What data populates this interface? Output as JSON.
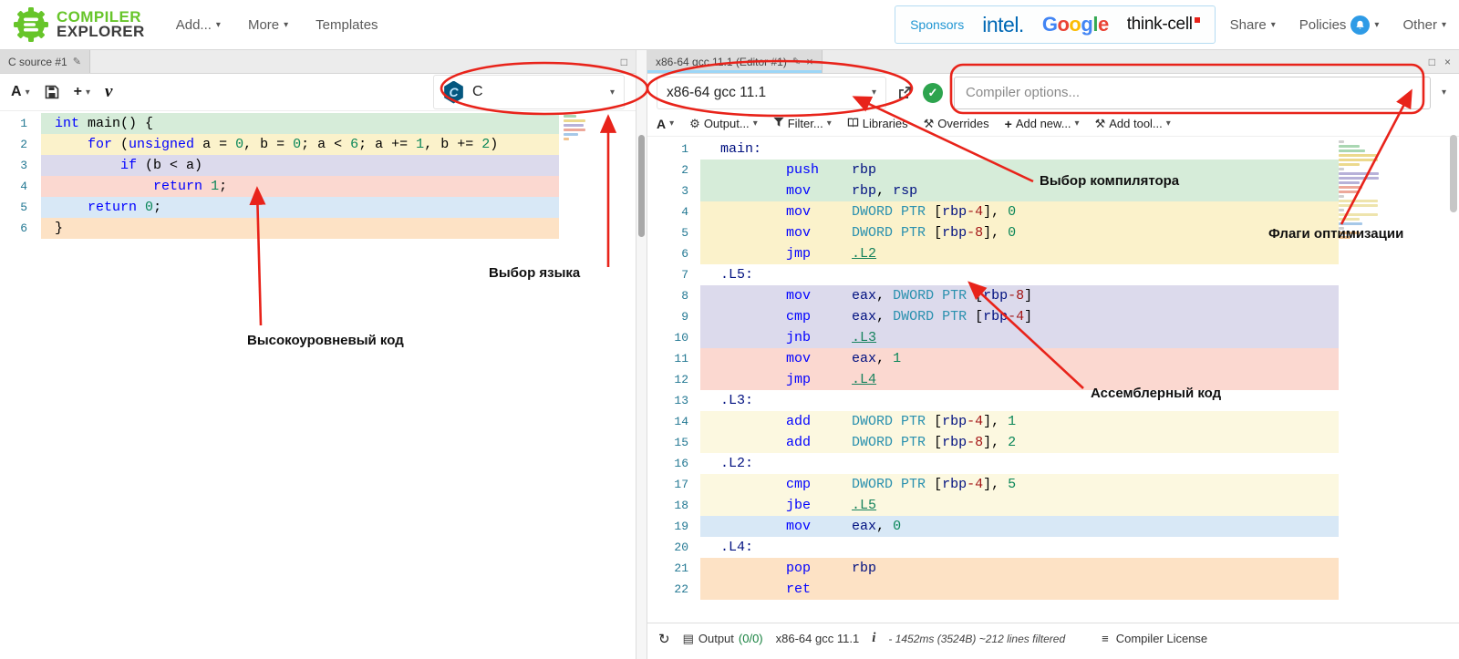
{
  "header": {
    "logo": {
      "line1": "COMPILER",
      "line2": "EXPLORER"
    },
    "nav": {
      "add": "Add...",
      "more": "More",
      "templates": "Templates"
    },
    "sponsors": {
      "label": "Sponsors",
      "intel": "intel.",
      "google": "Google",
      "google_colors": [
        "#4285F4",
        "#EA4335",
        "#FBBC05",
        "#4285F4",
        "#34A853",
        "#EA4335"
      ],
      "thinkcell": "think-cell"
    },
    "right_nav": {
      "share": "Share",
      "policies": "Policies",
      "other": "Other"
    }
  },
  "icons": {
    "caret": "▾",
    "pencil": "✎",
    "close": "×",
    "maximize": "□",
    "refresh": "↻",
    "gear": "⚙",
    "plus": "+",
    "hammer": "⚒",
    "grid": "▤",
    "lines": "≡",
    "check": "✓"
  },
  "source_pane": {
    "tab_title": "C source #1",
    "toolbar": {
      "font": "A",
      "vim": "v"
    },
    "language_select": {
      "value": "C",
      "logo_letter": "C"
    },
    "lines": [
      {
        "n": 1,
        "bg": "g",
        "tk": [
          [
            "k",
            "int"
          ],
          [
            "p",
            " main() {"
          ]
        ]
      },
      {
        "n": 2,
        "bg": "y",
        "tk": [
          [
            "p",
            "    "
          ],
          [
            "k",
            "for"
          ],
          [
            "p",
            " ("
          ],
          [
            "k",
            "unsigned"
          ],
          [
            "p",
            " a = "
          ],
          [
            "n",
            "0"
          ],
          [
            "p",
            ", b = "
          ],
          [
            "n",
            "0"
          ],
          [
            "p",
            "; a < "
          ],
          [
            "n",
            "6"
          ],
          [
            "p",
            "; a += "
          ],
          [
            "n",
            "1"
          ],
          [
            "p",
            ", b += "
          ],
          [
            "n",
            "2"
          ],
          [
            "p",
            ")"
          ]
        ]
      },
      {
        "n": 3,
        "bg": "v",
        "tk": [
          [
            "p",
            "        "
          ],
          [
            "k",
            "if"
          ],
          [
            "p",
            " (b < a)"
          ]
        ]
      },
      {
        "n": 4,
        "bg": "r",
        "tk": [
          [
            "p",
            "            "
          ],
          [
            "k",
            "return"
          ],
          [
            "p",
            " "
          ],
          [
            "n",
            "1"
          ],
          [
            "p",
            ";"
          ]
        ]
      },
      {
        "n": 5,
        "bg": "b",
        "tk": [
          [
            "p",
            "    "
          ],
          [
            "k",
            "return"
          ],
          [
            "p",
            " "
          ],
          [
            "n",
            "0"
          ],
          [
            "p",
            ";"
          ]
        ]
      },
      {
        "n": 6,
        "bg": "o",
        "tk": [
          [
            "p",
            "}"
          ]
        ]
      }
    ]
  },
  "compiler_pane": {
    "tab_title": "x86-64 gcc 11.1 (Editor #1)",
    "compiler_select": {
      "value": "x86-64 gcc 11.1"
    },
    "options_input": {
      "placeholder": "Compiler options..."
    },
    "toolbar": {
      "font": "A",
      "output": "Output...",
      "filter": "Filter...",
      "libraries": "Libraries",
      "overrides": "Overrides",
      "add_new": "Add new...",
      "add_tool": "Add tool..."
    },
    "lines": [
      {
        "n": 1,
        "bg": "",
        "tk": [
          [
            "l",
            "main:"
          ]
        ]
      },
      {
        "n": 2,
        "bg": "g",
        "tk": [
          [
            "p",
            "        "
          ],
          [
            "k",
            "push"
          ],
          [
            "p",
            "    "
          ],
          [
            "r",
            "rbp"
          ]
        ]
      },
      {
        "n": 3,
        "bg": "g",
        "tk": [
          [
            "p",
            "        "
          ],
          [
            "k",
            "mov"
          ],
          [
            "p",
            "     "
          ],
          [
            "r",
            "rbp"
          ],
          [
            "p",
            ", "
          ],
          [
            "r",
            "rsp"
          ]
        ]
      },
      {
        "n": 4,
        "bg": "y",
        "tk": [
          [
            "p",
            "        "
          ],
          [
            "k",
            "mov"
          ],
          [
            "p",
            "     "
          ],
          [
            "d",
            "DWORD PTR "
          ],
          [
            "p",
            "["
          ],
          [
            "r",
            "rbp"
          ],
          [
            "m",
            "-4"
          ],
          [
            "p",
            "], "
          ],
          [
            "n",
            "0"
          ]
        ]
      },
      {
        "n": 5,
        "bg": "y",
        "tk": [
          [
            "p",
            "        "
          ],
          [
            "k",
            "mov"
          ],
          [
            "p",
            "     "
          ],
          [
            "d",
            "DWORD PTR "
          ],
          [
            "p",
            "["
          ],
          [
            "r",
            "rbp"
          ],
          [
            "m",
            "-8"
          ],
          [
            "p",
            "], "
          ],
          [
            "n",
            "0"
          ]
        ]
      },
      {
        "n": 6,
        "bg": "y",
        "tk": [
          [
            "p",
            "        "
          ],
          [
            "k",
            "jmp"
          ],
          [
            "p",
            "     "
          ],
          [
            "j",
            ".L2"
          ]
        ]
      },
      {
        "n": 7,
        "bg": "",
        "tk": [
          [
            "l",
            ".L5:"
          ]
        ]
      },
      {
        "n": 8,
        "bg": "v",
        "tk": [
          [
            "p",
            "        "
          ],
          [
            "k",
            "mov"
          ],
          [
            "p",
            "     "
          ],
          [
            "r",
            "eax"
          ],
          [
            "p",
            ", "
          ],
          [
            "d",
            "DWORD PTR "
          ],
          [
            "p",
            "["
          ],
          [
            "r",
            "rbp"
          ],
          [
            "m",
            "-8"
          ],
          [
            "p",
            "]"
          ]
        ]
      },
      {
        "n": 9,
        "bg": "v",
        "tk": [
          [
            "p",
            "        "
          ],
          [
            "k",
            "cmp"
          ],
          [
            "p",
            "     "
          ],
          [
            "r",
            "eax"
          ],
          [
            "p",
            ", "
          ],
          [
            "d",
            "DWORD PTR "
          ],
          [
            "p",
            "["
          ],
          [
            "r",
            "rbp"
          ],
          [
            "m",
            "-4"
          ],
          [
            "p",
            "]"
          ]
        ]
      },
      {
        "n": 10,
        "bg": "v",
        "tk": [
          [
            "p",
            "        "
          ],
          [
            "k",
            "jnb"
          ],
          [
            "p",
            "     "
          ],
          [
            "j",
            ".L3"
          ]
        ]
      },
      {
        "n": 11,
        "bg": "r",
        "tk": [
          [
            "p",
            "        "
          ],
          [
            "k",
            "mov"
          ],
          [
            "p",
            "     "
          ],
          [
            "r",
            "eax"
          ],
          [
            "p",
            ", "
          ],
          [
            "n",
            "1"
          ]
        ]
      },
      {
        "n": 12,
        "bg": "r",
        "tk": [
          [
            "p",
            "        "
          ],
          [
            "k",
            "jmp"
          ],
          [
            "p",
            "     "
          ],
          [
            "j",
            ".L4"
          ]
        ]
      },
      {
        "n": 13,
        "bg": "",
        "tk": [
          [
            "l",
            ".L3:"
          ]
        ]
      },
      {
        "n": 14,
        "bg": "y2",
        "tk": [
          [
            "p",
            "        "
          ],
          [
            "k",
            "add"
          ],
          [
            "p",
            "     "
          ],
          [
            "d",
            "DWORD PTR "
          ],
          [
            "p",
            "["
          ],
          [
            "r",
            "rbp"
          ],
          [
            "m",
            "-4"
          ],
          [
            "p",
            "], "
          ],
          [
            "n",
            "1"
          ]
        ]
      },
      {
        "n": 15,
        "bg": "y2",
        "tk": [
          [
            "p",
            "        "
          ],
          [
            "k",
            "add"
          ],
          [
            "p",
            "     "
          ],
          [
            "d",
            "DWORD PTR "
          ],
          [
            "p",
            "["
          ],
          [
            "r",
            "rbp"
          ],
          [
            "m",
            "-8"
          ],
          [
            "p",
            "], "
          ],
          [
            "n",
            "2"
          ]
        ]
      },
      {
        "n": 16,
        "bg": "",
        "tk": [
          [
            "l",
            ".L2:"
          ]
        ]
      },
      {
        "n": 17,
        "bg": "y2",
        "tk": [
          [
            "p",
            "        "
          ],
          [
            "k",
            "cmp"
          ],
          [
            "p",
            "     "
          ],
          [
            "d",
            "DWORD PTR "
          ],
          [
            "p",
            "["
          ],
          [
            "r",
            "rbp"
          ],
          [
            "m",
            "-4"
          ],
          [
            "p",
            "], "
          ],
          [
            "n",
            "5"
          ]
        ]
      },
      {
        "n": 18,
        "bg": "y2",
        "tk": [
          [
            "p",
            "        "
          ],
          [
            "k",
            "jbe"
          ],
          [
            "p",
            "     "
          ],
          [
            "j",
            ".L5"
          ]
        ]
      },
      {
        "n": 19,
        "bg": "b",
        "tk": [
          [
            "p",
            "        "
          ],
          [
            "k",
            "mov"
          ],
          [
            "p",
            "     "
          ],
          [
            "r",
            "eax"
          ],
          [
            "p",
            ", "
          ],
          [
            "n",
            "0"
          ]
        ]
      },
      {
        "n": 20,
        "bg": "",
        "tk": [
          [
            "l",
            ".L4:"
          ]
        ]
      },
      {
        "n": 21,
        "bg": "o",
        "tk": [
          [
            "p",
            "        "
          ],
          [
            "k",
            "pop"
          ],
          [
            "p",
            "     "
          ],
          [
            "r",
            "rbp"
          ]
        ]
      },
      {
        "n": 22,
        "bg": "o",
        "tk": [
          [
            "p",
            "        "
          ],
          [
            "k",
            "ret"
          ]
        ]
      }
    ],
    "status_bar": {
      "output_label": "Output",
      "output_count": "(0/0)",
      "compiler_name": "x86-64 gcc 11.1",
      "info_icon": "i",
      "timing": "- 1452ms (3524B) ~212 lines filtered",
      "license_label": "Compiler License"
    }
  },
  "annotations": {
    "language": "Выбор языка",
    "source": "Высокоуровневый код",
    "compiler": "Выбор компилятора",
    "flags": "Флаги оптимизации",
    "assembly": "Ассемблерный код"
  },
  "colors": {
    "annotation_red": "#e8231a",
    "brand_green": "#67c52a",
    "status_ok_green": "#2da44e",
    "line_green": "#d6ecd9",
    "line_yellow": "#fbf2cb",
    "line_pale_yellow": "#fcf8e0",
    "line_violet": "#dcdaec",
    "line_red": "#fbd8d0",
    "line_blue": "#d8e8f6",
    "line_orange": "#fde2c5"
  }
}
